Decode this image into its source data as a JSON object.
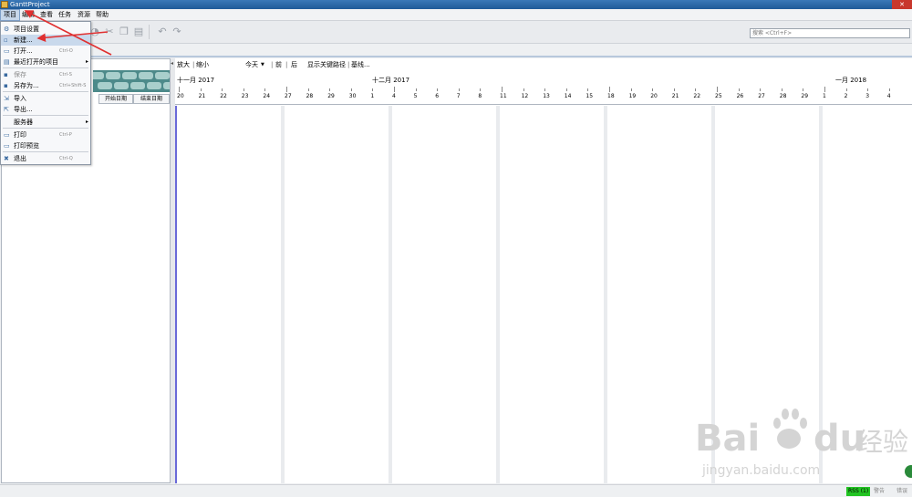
{
  "window": {
    "title": "GanttProject"
  },
  "menubar": [
    "项目",
    "编辑",
    "查看",
    "任务",
    "资源",
    "帮助"
  ],
  "project_menu": [
    {
      "icon": "project-settings-icon",
      "label": "项目设置",
      "shortcut": "",
      "disabled": false
    },
    {
      "icon": "new-file-icon",
      "label": "新建...",
      "shortcut": "",
      "disabled": false
    },
    {
      "icon": "open-folder-icon",
      "label": "打开...",
      "shortcut": "Ctrl-O",
      "disabled": false
    },
    {
      "icon": "recent-projects-icon",
      "label": "最近打开的项目",
      "shortcut": "",
      "disabled": false,
      "submenu": true
    },
    {
      "icon": "save-icon",
      "label": "保存",
      "shortcut": "Ctrl-S",
      "disabled": true
    },
    {
      "icon": "save-as-icon",
      "label": "另存为...",
      "shortcut": "Ctrl+Shift-S",
      "disabled": false
    },
    {
      "icon": "import-icon",
      "label": "导入",
      "shortcut": "",
      "disabled": false
    },
    {
      "icon": "export-icon",
      "label": "导出...",
      "shortcut": "",
      "disabled": false
    },
    {
      "icon": "server-icon",
      "label": "服务器",
      "shortcut": "",
      "disabled": false,
      "submenu": true
    },
    {
      "icon": "print-icon",
      "label": "打印",
      "shortcut": "Ctrl-P",
      "disabled": false
    },
    {
      "icon": "print-preview-icon",
      "label": "打印预览",
      "shortcut": "",
      "disabled": false
    },
    {
      "icon": "exit-icon",
      "label": "退出",
      "shortcut": "Ctrl-Q",
      "disabled": false
    }
  ],
  "search": {
    "placeholder": "搜索 <Ctrl+F>"
  },
  "task_table": {
    "columns": [
      "开始日期",
      "结束日期"
    ]
  },
  "gantt_toolbar": {
    "zoom_in": "放大",
    "sep1": "|",
    "zoom_out": "缩小",
    "today": "今天",
    "today_arrow": "▼",
    "sep2": "|",
    "prev": "前",
    "sep3": "|",
    "next": "后",
    "critical_path": "显示关键路径",
    "sep4": "|",
    "baseline": "基线..."
  },
  "timeline": {
    "months": [
      "十一月 2017",
      "十二月 2017",
      "一月 2018"
    ],
    "days": [
      "20",
      "21",
      "22",
      "23",
      "24",
      "27",
      "28",
      "29",
      "30",
      "1",
      "4",
      "5",
      "6",
      "7",
      "8",
      "11",
      "12",
      "13",
      "14",
      "15",
      "18",
      "19",
      "20",
      "21",
      "22",
      "25",
      "26",
      "27",
      "28",
      "29",
      "1",
      "2",
      "3",
      "4"
    ]
  },
  "statusbar": {
    "rss": "RSS (1)",
    "item2": "警告",
    "item3": "错误"
  },
  "watermark": {
    "brand_latin_1": "Bai",
    "brand_latin_2": "du",
    "brand_cn": "经验",
    "url": "jingyan.baidu.com"
  },
  "colors": {
    "titlebar": "#2a6aa8",
    "menu_highlight": "#c9d9ec",
    "annotation_arrow": "#e03030",
    "rss_badge": "#22c422"
  }
}
